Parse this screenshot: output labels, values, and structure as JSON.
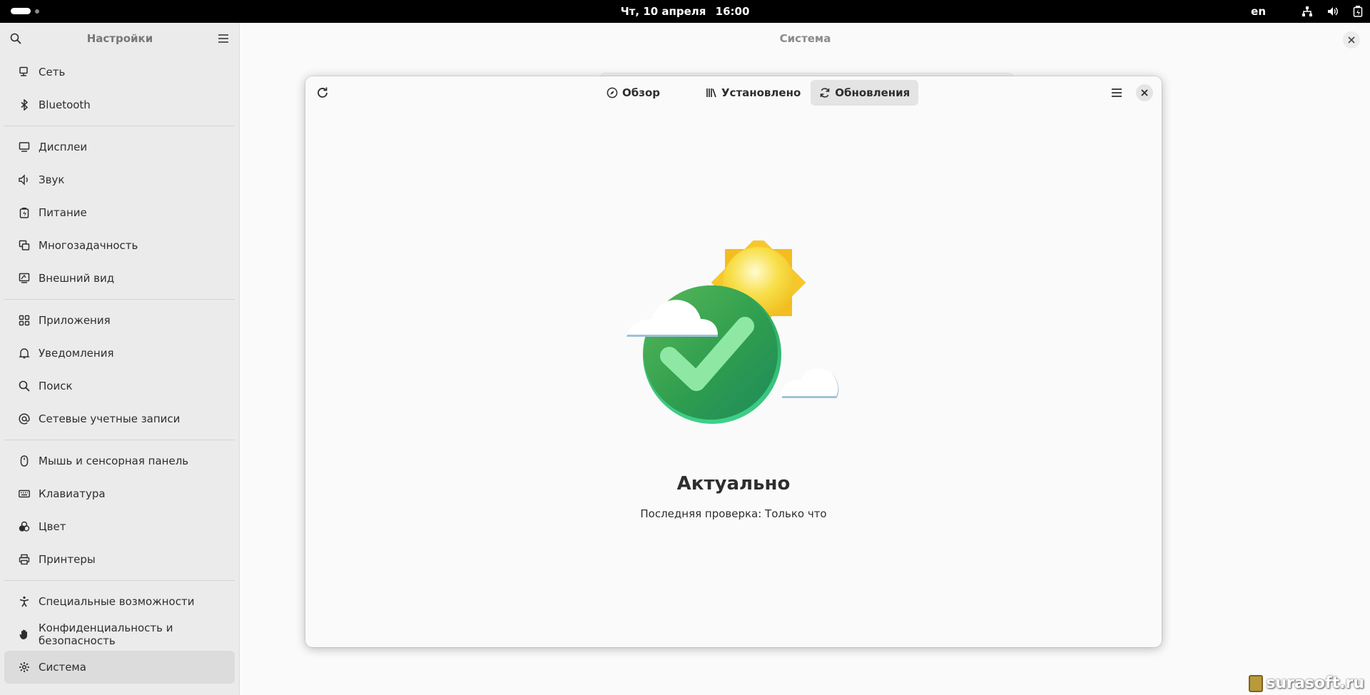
{
  "topbar": {
    "date": "Чт, 10 апреля",
    "time": "16:00",
    "lang": "en"
  },
  "sidebar": {
    "title": "Настройки",
    "groups": [
      [
        {
          "label": "Сеть",
          "icon": "network-icon"
        },
        {
          "label": "Bluetooth",
          "icon": "bluetooth-icon"
        }
      ],
      [
        {
          "label": "Дисплеи",
          "icon": "display-icon"
        },
        {
          "label": "Звук",
          "icon": "sound-icon"
        },
        {
          "label": "Питание",
          "icon": "power-icon"
        },
        {
          "label": "Многозадачность",
          "icon": "multitasking-icon"
        },
        {
          "label": "Внешний вид",
          "icon": "appearance-icon"
        }
      ],
      [
        {
          "label": "Приложения",
          "icon": "apps-icon"
        },
        {
          "label": "Уведомления",
          "icon": "bell-icon"
        },
        {
          "label": "Поиск",
          "icon": "search-icon"
        },
        {
          "label": "Сетевые учетные записи",
          "icon": "at-icon"
        }
      ],
      [
        {
          "label": "Мышь и сенсорная панель",
          "icon": "mouse-icon"
        },
        {
          "label": "Клавиатура",
          "icon": "keyboard-icon"
        },
        {
          "label": "Цвет",
          "icon": "color-icon"
        },
        {
          "label": "Принтеры",
          "icon": "printer-icon"
        }
      ],
      [
        {
          "label": "Специальные возможности",
          "icon": "accessibility-icon"
        },
        {
          "label": "Конфиденциальность и безопасность",
          "icon": "hand-icon"
        },
        {
          "label": "Система",
          "icon": "gear-icon",
          "active": true
        }
      ]
    ]
  },
  "main": {
    "title": "Система"
  },
  "dialog": {
    "tabs": [
      {
        "label": "Обзор",
        "icon": "compass-icon"
      },
      {
        "label": "Установлено",
        "icon": "library-icon"
      },
      {
        "label": "Обновления",
        "icon": "sync-icon",
        "active": true
      }
    ],
    "status_title": "Актуально",
    "status_sub": "Последняя проверка: Только что"
  },
  "watermark": "surasoft.ru",
  "colors": {
    "accent_green": "#2fae5f",
    "check_green": "#8ee8a4",
    "sun_yellow": "#f6cf2e"
  }
}
